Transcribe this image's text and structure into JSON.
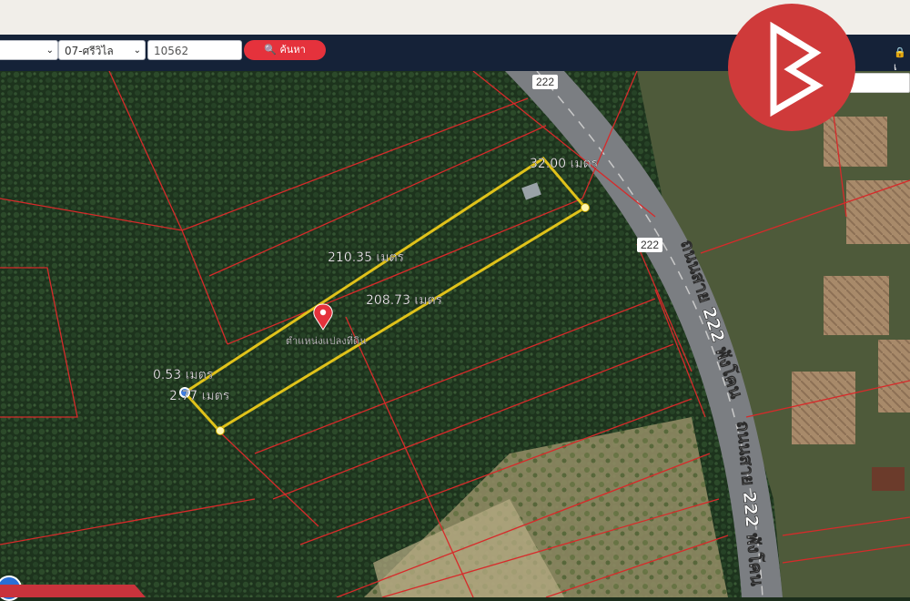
{
  "toolbar": {
    "province_value": "",
    "district_value": "07-ศรีวิไล",
    "postcode_value": "10562",
    "search_label": "ค้นหา",
    "search_icon": "magnifier-icon",
    "login_label": "เ",
    "login_icon": "lock-icon"
  },
  "map": {
    "route_shield": "222",
    "road_name": "ถนนสาย 222 พังโคน",
    "measurements": {
      "top_edge": "32.00 เมตร",
      "north_side": "210.35 เมตร",
      "south_side": "208.73 เมตร",
      "west_short": "0.53 เมตร",
      "west_edge": "2.77 เมตร"
    },
    "parcel_label": "ตำแหน่งแปลงที่ดิน",
    "pin_icon": "map-pin-icon"
  },
  "colors": {
    "navbar": "#152238",
    "accent_red": "#e5323c",
    "parcel_outline": "#e0c21a",
    "boundary_lines": "#d72a2a",
    "road_gray": "#7b7e82"
  },
  "footer": {
    "badge_text": ""
  }
}
